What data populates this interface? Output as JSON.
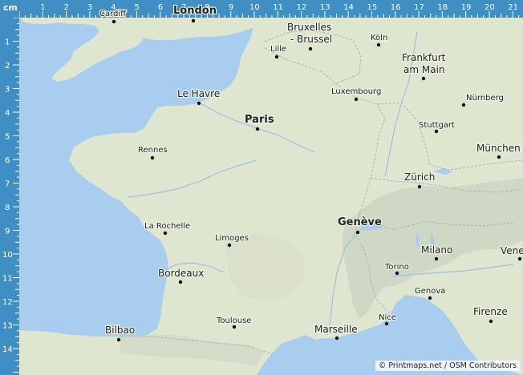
{
  "map": {
    "colors": {
      "sea": "#a9cdee",
      "land": "#dfe6d0",
      "alps": "#ccd3c2",
      "border": "#b9aab8",
      "river": "#9cc0e4",
      "ruler": "#3f8fc4"
    },
    "ruler": {
      "unit": "cm",
      "horizontal": [
        "1",
        "2",
        "3",
        "4",
        "5",
        "6",
        "7",
        "8",
        "9",
        "10",
        "11",
        "12",
        "13",
        "14",
        "15",
        "16",
        "17",
        "18",
        "19",
        "20",
        "21"
      ],
      "vertical": [
        "1",
        "2",
        "3",
        "4",
        "5",
        "6",
        "7",
        "8",
        "9",
        "10",
        "11",
        "12",
        "13",
        "14"
      ]
    },
    "cities": [
      {
        "name": "Cardiff",
        "size": "small"
      },
      {
        "name": "London",
        "size": "large"
      },
      {
        "name": "Bruxelles",
        "size": "medium"
      },
      {
        "name": "- Brussel",
        "size": "medium"
      },
      {
        "name": "Köln",
        "size": "small"
      },
      {
        "name": "Lille",
        "size": "small"
      },
      {
        "name": "Frankfurt",
        "size": "medium"
      },
      {
        "name": "am Main",
        "size": "medium"
      },
      {
        "name": "Le Havre",
        "size": "medium"
      },
      {
        "name": "Luxembourg",
        "size": "small"
      },
      {
        "name": "Nürnberg",
        "size": "small"
      },
      {
        "name": "Paris",
        "size": "large"
      },
      {
        "name": "Stuttgart",
        "size": "small"
      },
      {
        "name": "München",
        "size": "medium"
      },
      {
        "name": "Rennes",
        "size": "small"
      },
      {
        "name": "Zürich",
        "size": "medium"
      },
      {
        "name": "Genève",
        "size": "large"
      },
      {
        "name": "La Rochelle",
        "size": "small"
      },
      {
        "name": "Limoges",
        "size": "small"
      },
      {
        "name": "Milano",
        "size": "medium"
      },
      {
        "name": "Vene",
        "size": "medium"
      },
      {
        "name": "Torino",
        "size": "small"
      },
      {
        "name": "Bordeaux",
        "size": "medium"
      },
      {
        "name": "Genova",
        "size": "small"
      },
      {
        "name": "Toulouse",
        "size": "small"
      },
      {
        "name": "Firenze",
        "size": "medium"
      },
      {
        "name": "Bilbao",
        "size": "medium"
      },
      {
        "name": "Marseille",
        "size": "medium"
      },
      {
        "name": "Nice",
        "size": "small"
      }
    ],
    "attribution": "© Printmaps.net / OSM Contributors"
  }
}
